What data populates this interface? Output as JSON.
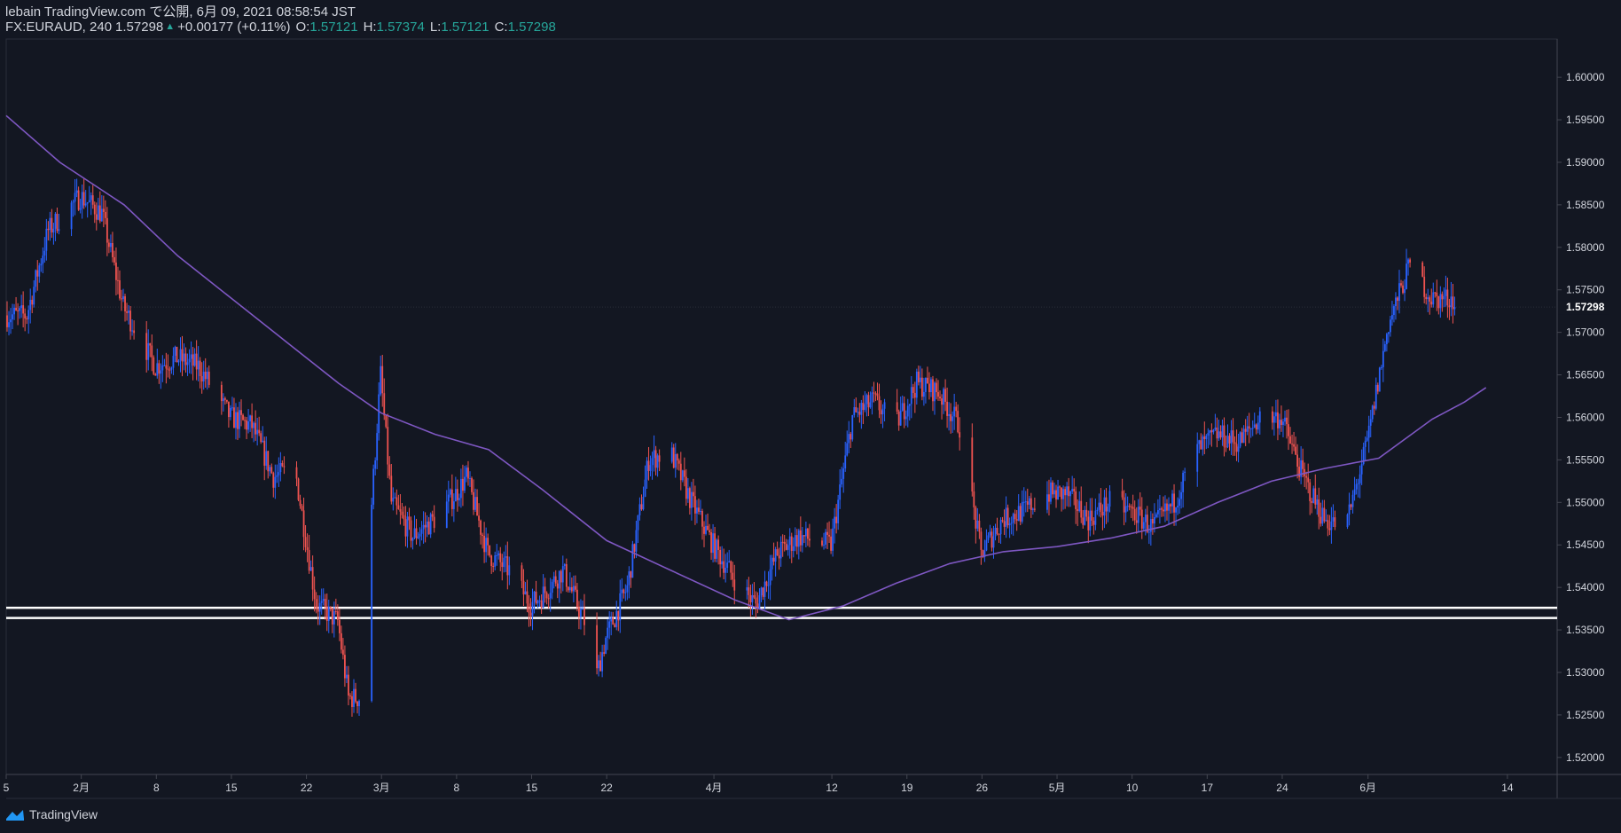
{
  "header": {
    "publish_line": "lebain TradingView.com で公開, 6月 09, 2021 08:58:54 JST",
    "symbol": "FX:EURAUD, 240",
    "last": "1.57298",
    "change": "+0.00177 (+0.11%)",
    "o_label": "O:",
    "o_value": "1.57121",
    "h_label": "H:",
    "h_value": "1.57374",
    "l_label": "L:",
    "l_value": "1.57121",
    "c_label": "C:",
    "c_value": "1.57298"
  },
  "footer": {
    "brand": "TradingView"
  },
  "colors": {
    "background": "#131722",
    "up": "#2962ff",
    "down": "#ef5350",
    "moving_average": "#7e57c2",
    "support_line": "#ffffff",
    "text": "#d1d4dc",
    "positive": "#26a69a"
  },
  "chart_data": {
    "type": "candlestick",
    "symbol": "FX:EURAUD",
    "timeframe": "240",
    "ylim": [
      1.518,
      1.6045
    ],
    "y_ticks": [
      "1.60000",
      "1.59500",
      "1.59000",
      "1.58500",
      "1.58000",
      "1.57500",
      "1.57000",
      "1.56500",
      "1.56000",
      "1.55500",
      "1.55000",
      "1.54500",
      "1.54000",
      "1.53500",
      "1.53000",
      "1.52500",
      "1.52000"
    ],
    "current_price_label": "1.57298",
    "current_price": 1.57298,
    "x_ticks": [
      "5",
      "2月",
      "8",
      "15",
      "22",
      "3月",
      "8",
      "15",
      "22",
      "4月",
      "12",
      "19",
      "26",
      "5月",
      "10",
      "17",
      "24",
      "6月",
      "14"
    ],
    "price_path": [
      {
        "date": "2021-01-25",
        "value": 1.572
      },
      {
        "date": "2021-01-27",
        "value": 1.572
      },
      {
        "date": "2021-01-29",
        "value": 1.582
      },
      {
        "date": "2021-02-01",
        "value": 1.586
      },
      {
        "date": "2021-02-03",
        "value": 1.584
      },
      {
        "date": "2021-02-05",
        "value": 1.573
      },
      {
        "date": "2021-02-08",
        "value": 1.566
      },
      {
        "date": "2021-02-10",
        "value": 1.567
      },
      {
        "date": "2021-02-12",
        "value": 1.566
      },
      {
        "date": "2021-02-15",
        "value": 1.56
      },
      {
        "date": "2021-02-17",
        "value": 1.559
      },
      {
        "date": "2021-02-19",
        "value": 1.553
      },
      {
        "date": "2021-02-21",
        "value": 1.554
      },
      {
        "date": "2021-02-23",
        "value": 1.538
      },
      {
        "date": "2021-02-25",
        "value": 1.536
      },
      {
        "date": "2021-02-26",
        "value": 1.527
      },
      {
        "date": "2021-02-27",
        "value": 1.527
      },
      {
        "date": "2021-02-28",
        "value": 1.547
      },
      {
        "date": "2021-03-01",
        "value": 1.565
      },
      {
        "date": "2021-03-02",
        "value": 1.55
      },
      {
        "date": "2021-03-04",
        "value": 1.546
      },
      {
        "date": "2021-03-06",
        "value": 1.548
      },
      {
        "date": "2021-03-08",
        "value": 1.551
      },
      {
        "date": "2021-03-09",
        "value": 1.553
      },
      {
        "date": "2021-03-11",
        "value": 1.544
      },
      {
        "date": "2021-03-13",
        "value": 1.542
      },
      {
        "date": "2021-03-15",
        "value": 1.538
      },
      {
        "date": "2021-03-16",
        "value": 1.539
      },
      {
        "date": "2021-03-18",
        "value": 1.542
      },
      {
        "date": "2021-03-20",
        "value": 1.536
      },
      {
        "date": "2021-03-21",
        "value": 1.529
      },
      {
        "date": "2021-03-22",
        "value": 1.534
      },
      {
        "date": "2021-03-24",
        "value": 1.54
      },
      {
        "date": "2021-03-26",
        "value": 1.555
      },
      {
        "date": "2021-03-28",
        "value": 1.556
      },
      {
        "date": "2021-03-30",
        "value": 1.55
      },
      {
        "date": "2021-04-01",
        "value": 1.545
      },
      {
        "date": "2021-04-03",
        "value": 1.541
      },
      {
        "date": "2021-04-05",
        "value": 1.538
      },
      {
        "date": "2021-04-07",
        "value": 1.544
      },
      {
        "date": "2021-04-09",
        "value": 1.546
      },
      {
        "date": "2021-04-12",
        "value": 1.545
      },
      {
        "date": "2021-04-14",
        "value": 1.56
      },
      {
        "date": "2021-04-16",
        "value": 1.562
      },
      {
        "date": "2021-04-18",
        "value": 1.559
      },
      {
        "date": "2021-04-20",
        "value": 1.564
      },
      {
        "date": "2021-04-22",
        "value": 1.563
      },
      {
        "date": "2021-04-24",
        "value": 1.559
      },
      {
        "date": "2021-04-26",
        "value": 1.544
      },
      {
        "date": "2021-04-28",
        "value": 1.548
      },
      {
        "date": "2021-04-30",
        "value": 1.549
      },
      {
        "date": "2021-05-02",
        "value": 1.551
      },
      {
        "date": "2021-05-04",
        "value": 1.551
      },
      {
        "date": "2021-05-06",
        "value": 1.548
      },
      {
        "date": "2021-05-08",
        "value": 1.55
      },
      {
        "date": "2021-05-10",
        "value": 1.549
      },
      {
        "date": "2021-05-12",
        "value": 1.547
      },
      {
        "date": "2021-05-14",
        "value": 1.55
      },
      {
        "date": "2021-05-16",
        "value": 1.556
      },
      {
        "date": "2021-05-18",
        "value": 1.558
      },
      {
        "date": "2021-05-20",
        "value": 1.557
      },
      {
        "date": "2021-05-22",
        "value": 1.56
      },
      {
        "date": "2021-05-24",
        "value": 1.56
      },
      {
        "date": "2021-05-26",
        "value": 1.553
      },
      {
        "date": "2021-05-28",
        "value": 1.548
      },
      {
        "date": "2021-05-30",
        "value": 1.547
      },
      {
        "date": "2021-06-01",
        "value": 1.557
      },
      {
        "date": "2021-06-03",
        "value": 1.571
      },
      {
        "date": "2021-06-05",
        "value": 1.578
      },
      {
        "date": "2021-06-07",
        "value": 1.574
      },
      {
        "date": "2021-06-09",
        "value": 1.574
      }
    ],
    "moving_average": [
      {
        "date": "2021-01-25",
        "value": 1.5955
      },
      {
        "date": "2021-01-30",
        "value": 1.59
      },
      {
        "date": "2021-02-05",
        "value": 1.585
      },
      {
        "date": "2021-02-10",
        "value": 1.579
      },
      {
        "date": "2021-02-15",
        "value": 1.574
      },
      {
        "date": "2021-02-20",
        "value": 1.569
      },
      {
        "date": "2021-02-25",
        "value": 1.564
      },
      {
        "date": "2021-03-01",
        "value": 1.5605
      },
      {
        "date": "2021-03-06",
        "value": 1.558
      },
      {
        "date": "2021-03-11",
        "value": 1.5562
      },
      {
        "date": "2021-03-16",
        "value": 1.5515
      },
      {
        "date": "2021-03-22",
        "value": 1.5455
      },
      {
        "date": "2021-03-28",
        "value": 1.542
      },
      {
        "date": "2021-04-03",
        "value": 1.5385
      },
      {
        "date": "2021-04-08",
        "value": 1.5362
      },
      {
        "date": "2021-04-13",
        "value": 1.5378
      },
      {
        "date": "2021-04-18",
        "value": 1.5405
      },
      {
        "date": "2021-04-23",
        "value": 1.5428
      },
      {
        "date": "2021-04-28",
        "value": 1.5442
      },
      {
        "date": "2021-05-03",
        "value": 1.5448
      },
      {
        "date": "2021-05-08",
        "value": 1.5458
      },
      {
        "date": "2021-05-13",
        "value": 1.5472
      },
      {
        "date": "2021-05-18",
        "value": 1.55
      },
      {
        "date": "2021-05-23",
        "value": 1.5525
      },
      {
        "date": "2021-05-28",
        "value": 1.554
      },
      {
        "date": "2021-06-02",
        "value": 1.5552
      },
      {
        "date": "2021-06-07",
        "value": 1.5598
      },
      {
        "date": "2021-06-10",
        "value": 1.5618
      },
      {
        "date": "2021-06-12",
        "value": 1.5635
      }
    ],
    "horizontal_lines": [
      1.5376,
      1.5364
    ]
  }
}
